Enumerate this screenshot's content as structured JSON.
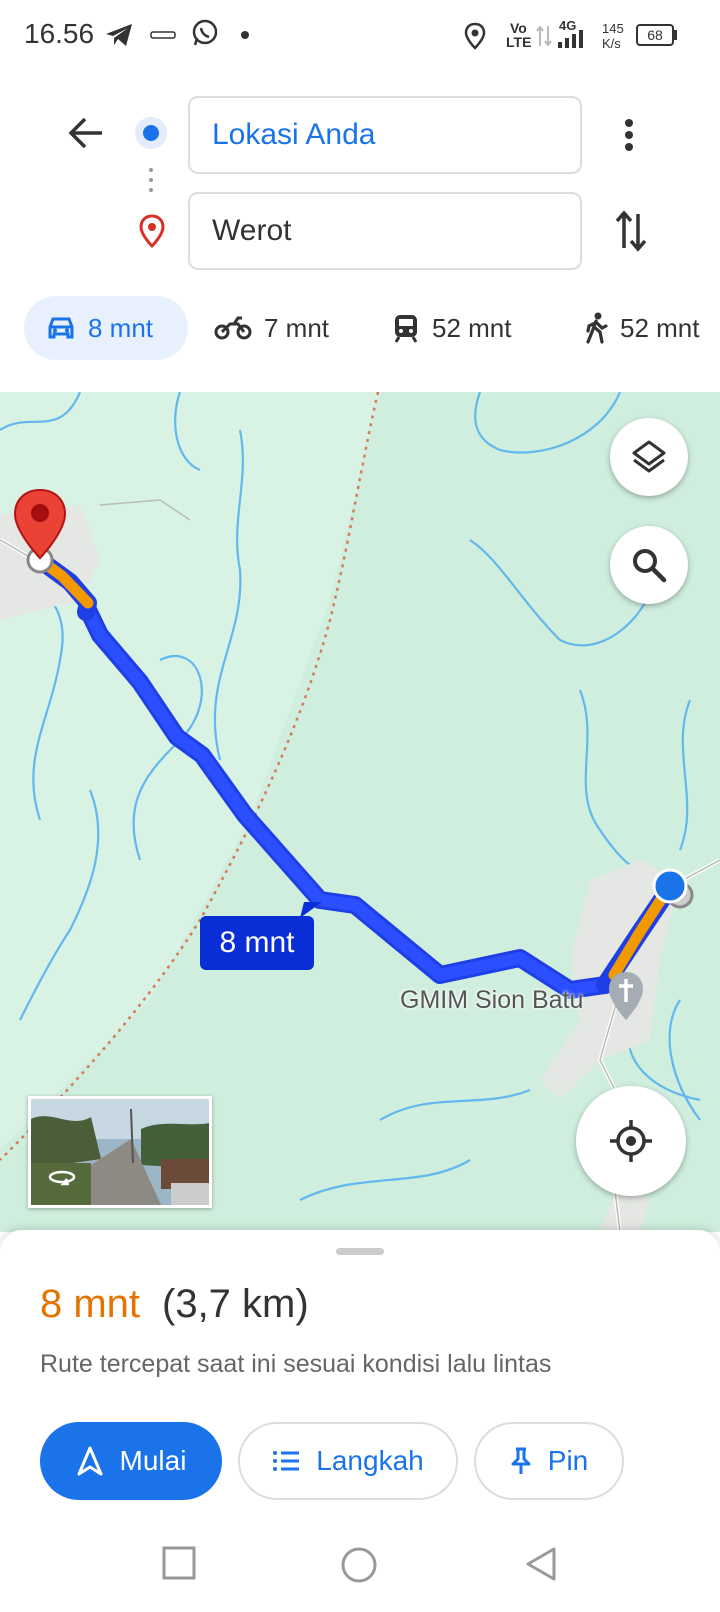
{
  "status_bar": {
    "time": "16.56",
    "volte_top": "Vo",
    "volte_bottom": "LTE",
    "net_type": "4G",
    "speed_value": "145",
    "speed_unit": "K/s",
    "battery": "68"
  },
  "route_inputs": {
    "origin": "Lokasi Anda",
    "destination": "Werot"
  },
  "travel_modes": [
    {
      "label": "8 mnt",
      "icon": "car-icon",
      "selected": true
    },
    {
      "label": "7 mnt",
      "icon": "motorcycle-icon",
      "selected": false
    },
    {
      "label": "52 mnt",
      "icon": "transit-icon",
      "selected": false
    },
    {
      "label": "52 mnt",
      "icon": "walk-icon",
      "selected": false
    }
  ],
  "map": {
    "route_eta_label": "8 mnt",
    "place_label": "GMIM Sion Batu"
  },
  "summary": {
    "duration": "8 mnt",
    "distance": "(3,7 km)",
    "description": "Rute tercepat saat ini sesuai kondisi lalu lintas"
  },
  "actions": {
    "start": "Mulai",
    "steps": "Langkah",
    "pin": "Pin"
  },
  "colors": {
    "accent": "#1a73e8",
    "route": "#0a2ed6",
    "traffic_slow": "#f29900",
    "duration": "#e37400",
    "map_bg": "#cfeedd"
  }
}
